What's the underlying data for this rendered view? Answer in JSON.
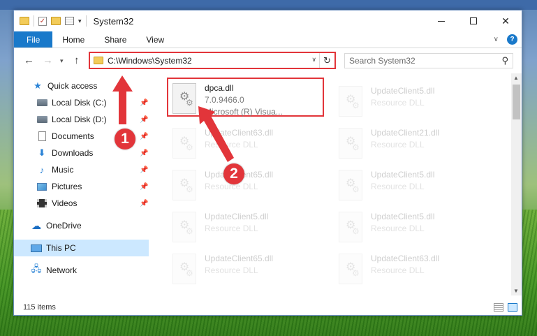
{
  "window": {
    "title": "System32",
    "controls": {
      "minimize": "—",
      "maximize": "☐",
      "close": "✕"
    }
  },
  "ribbon": {
    "tabs": [
      "File",
      "Home",
      "Share",
      "View"
    ],
    "help": "?"
  },
  "address": {
    "path": "C:\\Windows\\System32",
    "search_placeholder": "Search System32"
  },
  "navigation": {
    "items": [
      {
        "label": "Quick access",
        "icon": "star-icon",
        "pinned": false
      },
      {
        "label": "Local Disk (C:)",
        "icon": "drive-icon",
        "pinned": true
      },
      {
        "label": "Local Disk (D:)",
        "icon": "drive-icon",
        "pinned": true
      },
      {
        "label": "Documents",
        "icon": "documents-icon",
        "pinned": true
      },
      {
        "label": "Downloads",
        "icon": "downloads-icon",
        "pinned": true
      },
      {
        "label": "Music",
        "icon": "music-icon",
        "pinned": true
      },
      {
        "label": "Pictures",
        "icon": "pictures-icon",
        "pinned": true
      },
      {
        "label": "Videos",
        "icon": "videos-icon",
        "pinned": true
      },
      {
        "label": "OneDrive",
        "icon": "onedrive-icon",
        "pinned": false
      },
      {
        "label": "This PC",
        "icon": "this-pc-icon",
        "pinned": false,
        "selected": true
      },
      {
        "label": "Network",
        "icon": "network-icon",
        "pinned": false
      }
    ]
  },
  "files": [
    {
      "name": "dpca.dll",
      "version": "7.0.9466.0",
      "description": "Microsoft (R) Visua...",
      "highlighted": true
    },
    {
      "name": "UpdateClient5.dll",
      "description": "Resource DLL"
    },
    {
      "name": "UpdateClient63.dll",
      "description": "Resource DLL"
    },
    {
      "name": "UpdateClient21.dll",
      "description": "Resource DLL"
    },
    {
      "name": "UpdateClient65.dll",
      "description": "Resource DLL"
    },
    {
      "name": "UpdateClient5.dll",
      "description": "Resource DLL"
    },
    {
      "name": "UpdateClient5.dll",
      "description": "Resource DLL"
    },
    {
      "name": "UpdateClient5.dll",
      "description": "Resource DLL"
    },
    {
      "name": "UpdateClient65.dll",
      "description": "Resource DLL"
    },
    {
      "name": "UpdateClient63.dll",
      "description": "Resource DLL"
    }
  ],
  "status": {
    "item_count": "115 items"
  },
  "annotations": {
    "step1": "1",
    "step2": "2",
    "color": "#e2353a"
  }
}
